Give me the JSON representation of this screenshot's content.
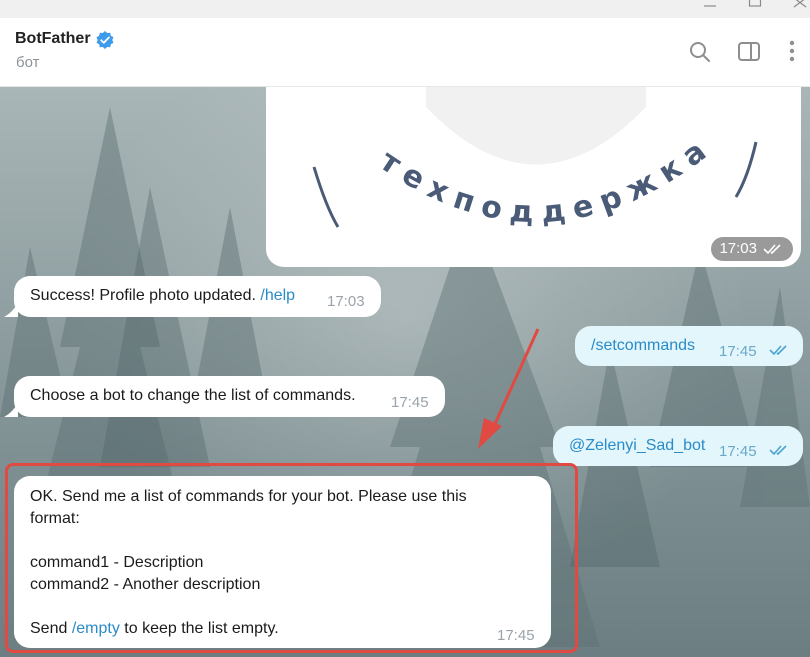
{
  "window": {
    "controls": [
      "minimize",
      "maximize",
      "close"
    ]
  },
  "header": {
    "title": "BotFather",
    "subtitle": "бот",
    "verified": true,
    "actions": [
      "search-icon",
      "sidebar-toggle-icon",
      "more-vertical-icon"
    ]
  },
  "image_message": {
    "caption_text": "техподдержка",
    "time": "17:03"
  },
  "messages": [
    {
      "direction": "in",
      "text": "Success! Profile photo updated. ",
      "link": "/help",
      "time": "17:03"
    },
    {
      "direction": "out",
      "link": "/setcommands",
      "time": "17:45"
    },
    {
      "direction": "in",
      "text": "Choose a bot to change the list of commands.",
      "time": "17:45"
    },
    {
      "direction": "out",
      "link": "@Zelenyi_Sad_bot",
      "time": "17:45"
    },
    {
      "direction": "in",
      "line1": "OK. Send me a list of commands for your bot. Please use this",
      "line2": "format:",
      "line3": "command1 - Description",
      "line4": "command2 - Another description",
      "line5_pre": "Send ",
      "line5_link": "/empty",
      "line5_post": " to keep the list empty.",
      "time": "17:45"
    }
  ],
  "colors": {
    "incoming_bubble": "#ffffff",
    "outgoing_bubble": "#e2f6fc",
    "link": "#2a8bc8",
    "highlight": "#e04a43",
    "verified": "#3d9be9"
  }
}
